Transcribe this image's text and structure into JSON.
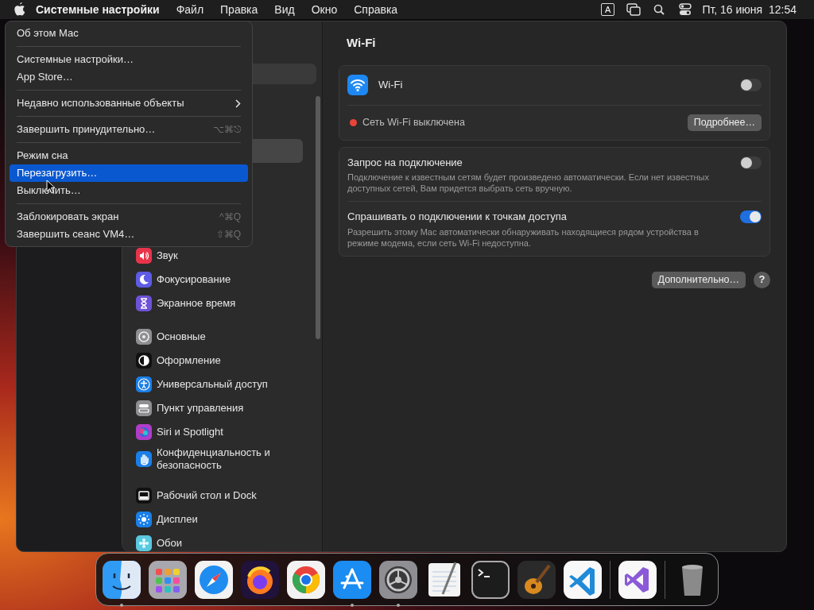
{
  "menu_bar": {
    "app_name": "Системные настройки",
    "menus": [
      "Файл",
      "Правка",
      "Вид",
      "Окно",
      "Справка"
    ],
    "input_source": "A",
    "clock": "Пт, 16 июня  12:54"
  },
  "apple_menu": {
    "groups": [
      [
        {
          "label": "Об этом Mac",
          "selected": false
        }
      ],
      [
        {
          "label": "Системные настройки…",
          "selected": false
        },
        {
          "label": "App Store…",
          "selected": false
        }
      ],
      [
        {
          "label": "Недавно использованные объекты",
          "submenu": true,
          "selected": false
        }
      ],
      [
        {
          "label": "Завершить принудительно…",
          "shortcut": "⌥⌘⎋",
          "selected": false
        }
      ],
      [
        {
          "label": "Режим сна",
          "selected": false
        },
        {
          "label": "Перезагрузить…",
          "selected": true
        },
        {
          "label": "Выключить…",
          "selected": false
        }
      ],
      [
        {
          "label": "Заблокировать экран",
          "shortcut": "^⌘Q",
          "selected": false
        },
        {
          "label": "Завершить сеанс VM4…",
          "shortcut": "⇧⌘Q",
          "selected": false
        }
      ]
    ]
  },
  "sidebar": {
    "groups": [
      [
        {
          "label": "Звук",
          "kind": "sound",
          "color": "#e8344a"
        },
        {
          "label": "Фокусирование",
          "kind": "moon",
          "color": "#5e5ce6"
        },
        {
          "label": "Экранное время",
          "kind": "hourglass",
          "color": "#6e52d8"
        }
      ],
      [
        {
          "label": "Основные",
          "kind": "gear",
          "color": "#8e8e93"
        },
        {
          "label": "Оформление",
          "kind": "contrast",
          "color": "#111111"
        },
        {
          "label": "Универсальный доступ",
          "kind": "person",
          "color": "#1a7fe8"
        },
        {
          "label": "Пункт управления",
          "kind": "switches",
          "color": "#8e8e93"
        },
        {
          "label": "Siri и Spotlight",
          "kind": "siri",
          "color": "#b03cc8"
        },
        {
          "label": "Конфиденциальность и безопасность",
          "kind": "hand",
          "color": "#1a7fe8"
        }
      ],
      [
        {
          "label": "Рабочий стол и Dock",
          "kind": "dock",
          "color": "#111111"
        },
        {
          "label": "Дисплеи",
          "kind": "sun",
          "color": "#1a7fe8"
        },
        {
          "label": "Обои",
          "kind": "flower",
          "color": "#5ac8e0"
        }
      ]
    ]
  },
  "content": {
    "title": "Wi-Fi",
    "wifi": {
      "label": "Wi-Fi",
      "on": false,
      "status": "Сеть Wi-Fi выключена",
      "details_button": "Подробнее…"
    },
    "options": [
      {
        "title": "Запрос на подключение",
        "description": "Подключение к известным сетям будет произведено автоматически. Если нет известных доступных сетей, Вам придется выбрать сеть вручную.",
        "on": false
      },
      {
        "title": "Спрашивать о подключении к точкам доступа",
        "description": "Разрешить этому Mac автоматически обнаруживать находящиеся рядом устройства в режиме модема, если сеть Wi-Fi недоступна.",
        "on": true
      }
    ],
    "advanced_button": "Дополнительно…",
    "help_button": "?"
  },
  "dock": {
    "items": [
      {
        "kind": "finder",
        "running": true
      },
      {
        "kind": "launchpad",
        "running": false
      },
      {
        "kind": "safari",
        "running": false
      },
      {
        "kind": "firefox",
        "running": false
      },
      {
        "kind": "chrome",
        "running": false
      },
      {
        "kind": "appstore",
        "running": true
      },
      {
        "kind": "settings",
        "running": true
      },
      {
        "kind": "textedit",
        "running": false
      },
      {
        "kind": "terminal",
        "running": false
      },
      {
        "kind": "garageband",
        "running": false
      },
      {
        "kind": "vscode",
        "running": false
      },
      {
        "kind": "divider"
      },
      {
        "kind": "visualstudio",
        "running": false
      },
      {
        "kind": "divider"
      },
      {
        "kind": "trash",
        "running": false
      }
    ]
  }
}
